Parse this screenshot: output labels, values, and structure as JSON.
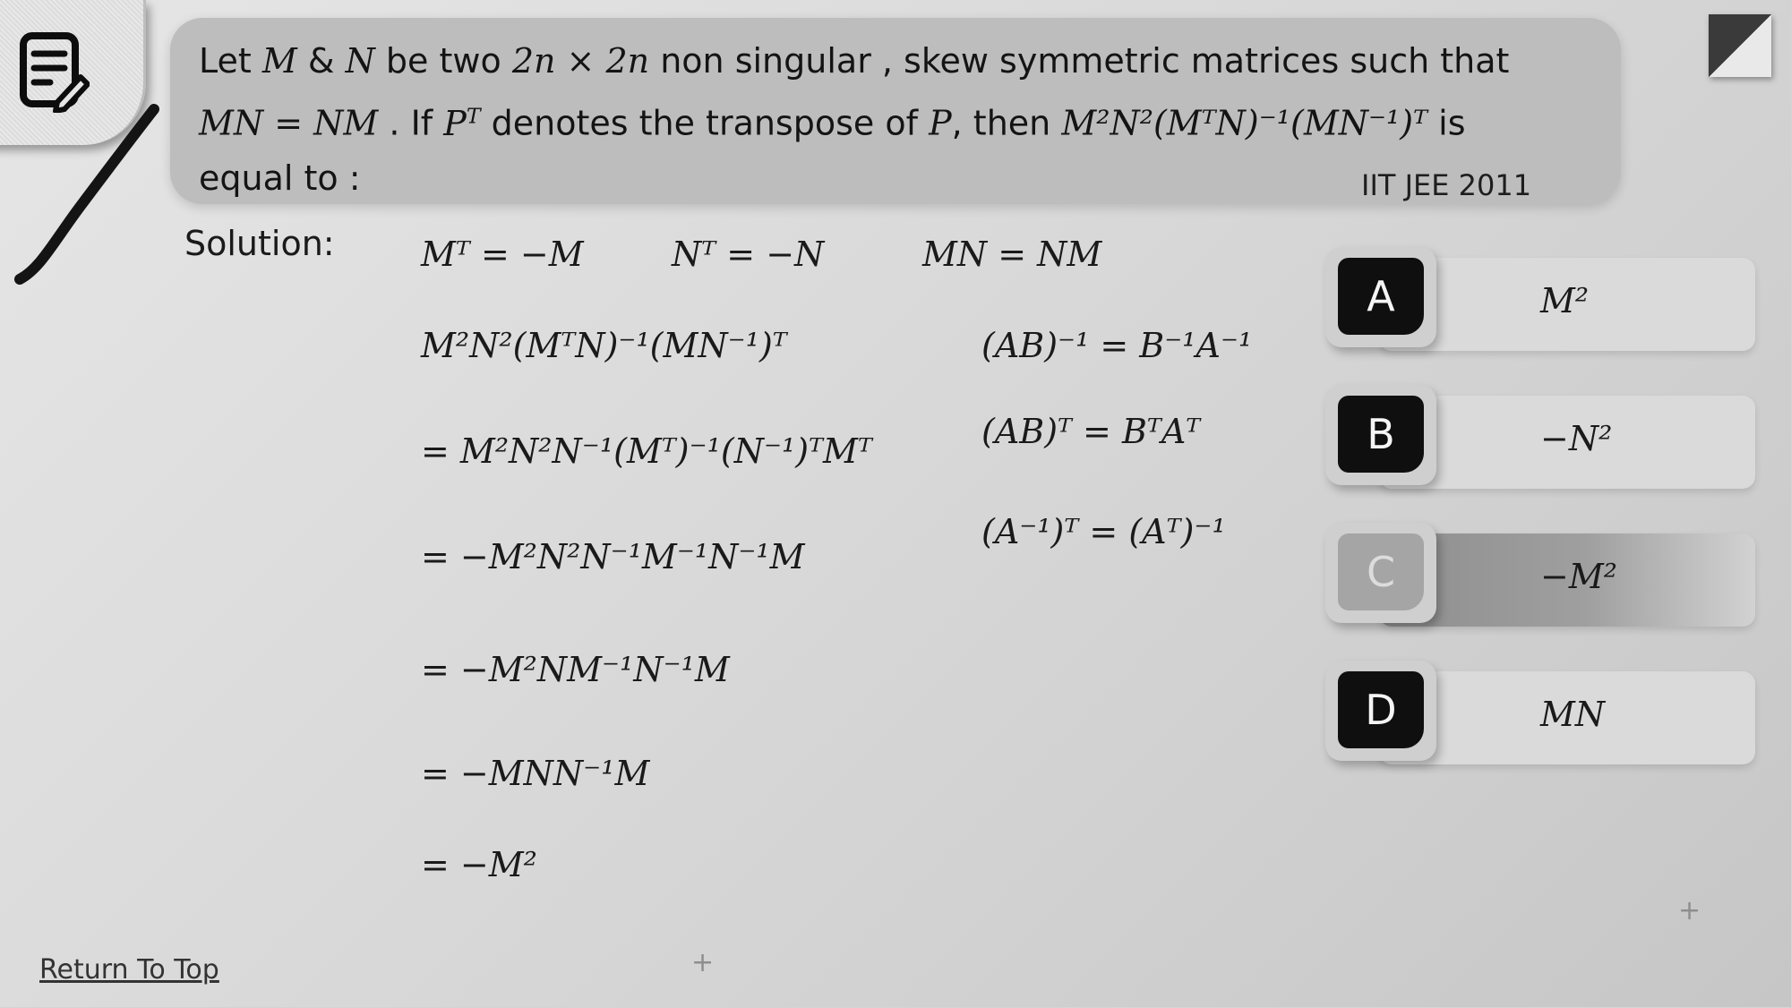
{
  "question": {
    "line1": {
      "t1": "Let ",
      "m1": "M",
      "t2": " & ",
      "m2": "N",
      "t3": " be two ",
      "m3": "2n × 2n",
      "t4": " non singular , skew symmetric matrices such that"
    },
    "line2": {
      "m1": "MN = NM",
      "t1": " . If ",
      "m2": "P",
      "m2sup": "T",
      "t2": "  denotes the transpose of ",
      "m3": "P",
      "t3": ", then ",
      "expr": "M²N²(MᵀN)⁻¹(MN⁻¹)ᵀ",
      "t4": " is"
    },
    "line3": "equal to :",
    "exam_tag": "IIT JEE 2011"
  },
  "solution": {
    "label": "Solution:",
    "given": [
      "Mᵀ = −M",
      "Nᵀ = −N",
      "MN = NM"
    ],
    "steps": [
      "M²N²(MᵀN)⁻¹(MN⁻¹)ᵀ",
      "= M²N²N⁻¹(Mᵀ)⁻¹(N⁻¹)ᵀMᵀ",
      "= −M²N²N⁻¹M⁻¹N⁻¹M",
      "= −M²NM⁻¹N⁻¹M",
      "= −MNN⁻¹M",
      "= −M²"
    ],
    "rules": [
      "(AB)⁻¹ = B⁻¹A⁻¹",
      "(AB)ᵀ = BᵀAᵀ",
      "(A⁻¹)ᵀ = (Aᵀ)⁻¹"
    ]
  },
  "options": [
    {
      "letter": "A",
      "value": "M²"
    },
    {
      "letter": "B",
      "value": "−N²"
    },
    {
      "letter": "C",
      "value": "−M²"
    },
    {
      "letter": "D",
      "value": "MN"
    }
  ],
  "selected_option": "C",
  "footer": {
    "return_label": "Return To Top",
    "plus_glyph": "+"
  },
  "colors": {
    "question_bg": "#bdbdbd",
    "option_badge": "#0f0f0f",
    "selected_badge": "#a5a5a5"
  },
  "icons": [
    "note-edit-icon",
    "pen-stroke-icon",
    "corner-logo-icon"
  ]
}
